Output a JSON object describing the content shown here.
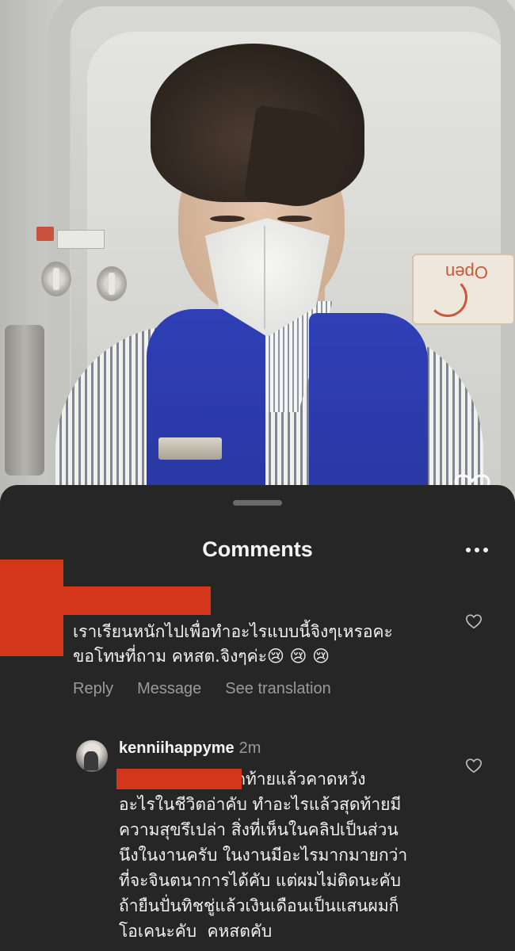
{
  "video": {
    "scene_sign": "Open"
  },
  "comments_sheet": {
    "title": "Comments",
    "more_icon": "more-horizontal-icon"
  },
  "comment": {
    "lines": [
      "เราเรียนหนักไปเพื่อทำอะไรแบบนี้จิงๆเหรอคะ",
      "ขอโทษที่ถาม คหสต.จิงๆค่ะ😢 😢 😢"
    ],
    "actions": {
      "reply": "Reply",
      "message": "Message",
      "see_translation": "See translation"
    }
  },
  "reply": {
    "username": "kenniihappyme",
    "time": "2m",
    "lines": [
      "                    สุดท้ายแล้วคาดหวัง",
      "อะไรในชีวิตอ่าคับ ทำอะไรแล้วสุดท้ายมี",
      "ความสุขรึเปล่า สิ่งที่เห็นในคลิปเป็นส่วน",
      "นึงในงานครับ ในงานมีอะไรมากมายกว่า",
      "ที่จะจินตนาการได้คับ แต่ผมไม่ติดนะคับ",
      "ถ้ายืนปั่นทิชชู่แล้วเงินเดือนเป็นแสนผมก็",
      "โอเคนะคับ  คหสตคับ"
    ]
  },
  "colors": {
    "sheet_bg": "#262626",
    "redaction": "#d4361b",
    "secondary_text": "#9a9a9a"
  }
}
